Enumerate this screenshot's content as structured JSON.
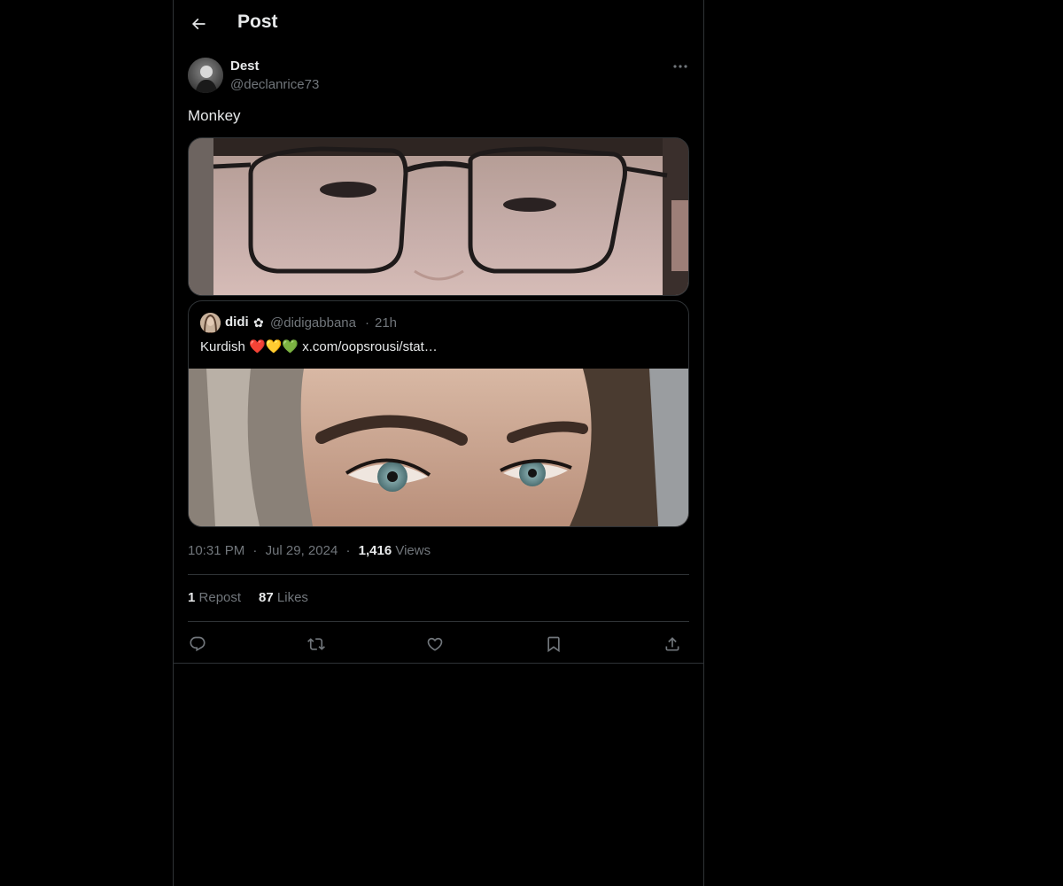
{
  "header": {
    "title": "Post"
  },
  "post": {
    "author": {
      "display_name": "Dest",
      "handle": "@declanrice73"
    },
    "text": "Monkey",
    "meta": {
      "time": "10:31 PM",
      "sep1": "·",
      "date": "Jul 29, 2024",
      "sep2": "·",
      "views_count": "1,416",
      "views_label": "Views"
    },
    "stats": {
      "reposts_count": "1",
      "reposts_label": "Repost",
      "likes_count": "87",
      "likes_label": "Likes"
    }
  },
  "quote": {
    "display_name": "didi",
    "badge": "✿",
    "handle": "@didigabbana",
    "dot": "·",
    "time": "21h",
    "text": "Kurdish ❤️💛💚 x.com/oopsrousi/stat…"
  },
  "icons": {
    "back": "arrow-left-icon",
    "more": "more-horizontal-icon",
    "reply": "reply-icon",
    "repost": "repost-icon",
    "like": "heart-icon",
    "bookmark": "bookmark-icon",
    "share": "share-icon"
  },
  "colors": {
    "background": "#000000",
    "text": "#e7e9ea",
    "secondary": "#71767b",
    "border": "#2f3336"
  }
}
